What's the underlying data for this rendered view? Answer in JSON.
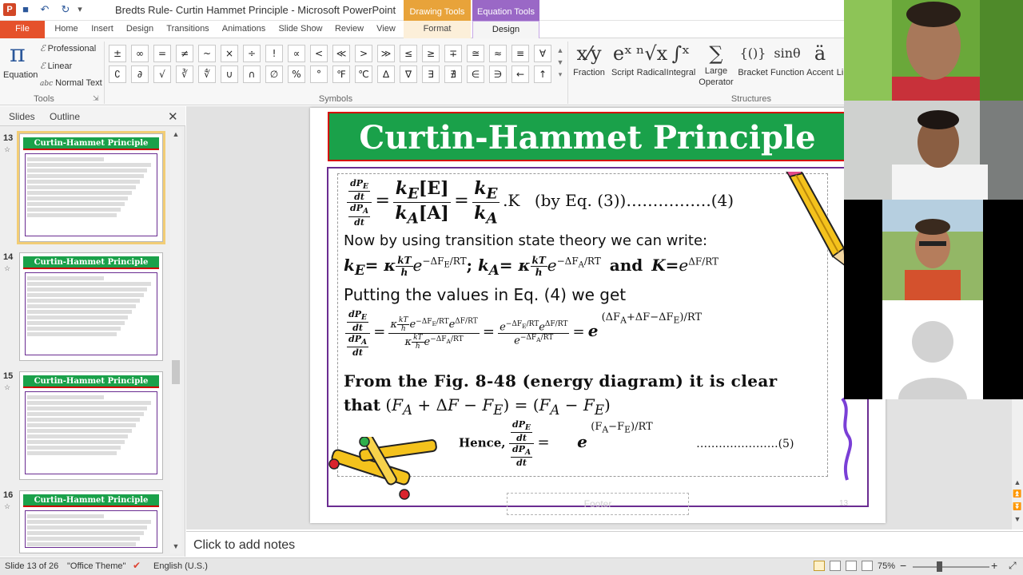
{
  "window": {
    "title": "Bredts Rule- Curtin Hammet Principle  -  Microsoft PowerPoint",
    "ctx_drawing": "Drawing Tools",
    "ctx_equation": "Equation Tools",
    "qat_dropdown": "▾"
  },
  "tabs": [
    "File",
    "Home",
    "Insert",
    "Design",
    "Transitions",
    "Animations",
    "Slide Show",
    "Review",
    "View",
    "Format",
    "Design"
  ],
  "ribbon": {
    "tools": {
      "equation_label": "Equation",
      "equation_symbol": "π",
      "professional": "Professional",
      "linear": "Linear",
      "normal_text": "Normal Text",
      "group_label": "Tools",
      "launcher": "⇲"
    },
    "symbols": {
      "group_label": "Symbols",
      "row1": [
        "±",
        "∞",
        "=",
        "≠",
        "~",
        "×",
        "÷",
        "!",
        "∝",
        "<",
        "≪",
        ">",
        "≫",
        "≤",
        "≥",
        "∓",
        "≅",
        "≈",
        "≡",
        "∀"
      ],
      "row2": [
        "∁",
        "∂",
        "√",
        "∛",
        "∜",
        "∪",
        "∩",
        "∅",
        "%",
        "°",
        "℉",
        "℃",
        "∆",
        "∇",
        "∃",
        "∄",
        "∈",
        "∋",
        "←",
        "↑"
      ],
      "scroll": [
        "▲",
        "▼",
        "▾"
      ]
    },
    "structures": {
      "group_label": "Structures",
      "items": [
        {
          "label": "Fraction",
          "glyph": "x⁄y"
        },
        {
          "label": "Script",
          "glyph": "eˣ"
        },
        {
          "label": "Radical",
          "glyph": "ⁿ√x"
        },
        {
          "label": "Integral",
          "glyph": "∫ˣ"
        },
        {
          "label": "Large Operator",
          "glyph": "∑"
        },
        {
          "label": "Bracket",
          "glyph": "{()}"
        },
        {
          "label": "Function",
          "glyph": "sinθ"
        },
        {
          "label": "Accent",
          "glyph": "ä"
        },
        {
          "label": "Li",
          "glyph": ""
        }
      ]
    }
  },
  "left_panel": {
    "tab_slides": "Slides",
    "tab_outline": "Outline",
    "close": "✕",
    "thumbnails": [
      {
        "number": "13",
        "title": "Curtin-Hammet Principle",
        "selected": true
      },
      {
        "number": "14",
        "title": "Curtin-Hammet Principle",
        "selected": false
      },
      {
        "number": "15",
        "title": "Curtin-Hammet Principle",
        "selected": false
      },
      {
        "number": "16",
        "title": "Curtin-Hammet Principle",
        "selected": false
      }
    ]
  },
  "slide": {
    "title": "Curtin-Hammet Principle",
    "eq4_label": "(by Eq. (3))…………….(4)",
    "line_now": "Now by using transition state theory we can write:",
    "line_putting": "Putting the values in Eq. (4) we get",
    "line_from": "From the Fig. 8-48 (energy diagram) it is clear",
    "line_that": "that",
    "hence": "Hence,",
    "eq5_label": "………………….(5)",
    "footer": "Footer",
    "number": "13",
    "and": "and"
  },
  "notes": {
    "placeholder": "Click to add notes"
  },
  "status": {
    "slide_info": "Slide 13 of 26",
    "theme": "\"Office Theme\"",
    "language": "English (U.S.)",
    "zoom": "75%",
    "zoom_minus": "−",
    "zoom_plus": "+",
    "fit_icon": "⤢"
  },
  "colors": {
    "title_green": "#1aa14a",
    "title_border": "#d60000",
    "frame_purple": "#6a2c91",
    "file_orange": "#e5512b",
    "equation_purple": "#9a68c6",
    "drawing_orange": "#e8a33a"
  }
}
